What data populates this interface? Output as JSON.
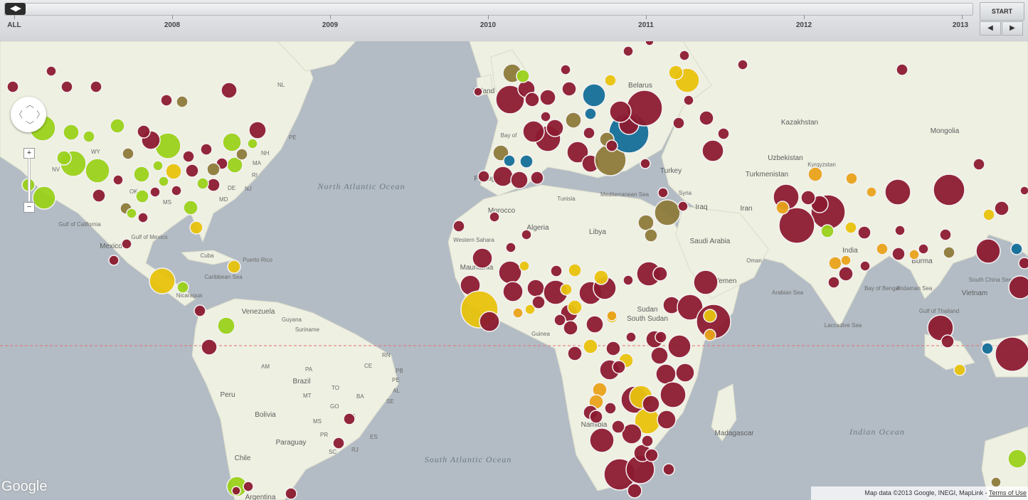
{
  "timeline": {
    "handle_label": "◀▶",
    "all_label": "ALL",
    "years": [
      "2008",
      "2009",
      "2010",
      "2011",
      "2012",
      "2013"
    ],
    "start_label": "START",
    "prev_icon": "◀",
    "next_icon": "▶"
  },
  "map": {
    "zoom_in": "+",
    "zoom_out": "−",
    "google_label": "Google",
    "attribution": "Map data ©2013 Google, INEGI, MapLink",
    "terms_label": "Terms of Use",
    "country_labels": [
      "Venezuela",
      "Guyana",
      "Suriname",
      "Brazil",
      "Peru",
      "Bolivia",
      "Paraguay",
      "Chile",
      "Argentina",
      "Mexico",
      "Cuba",
      "Puerto Rico",
      "Nicaragua",
      "Algeria",
      "Libya",
      "Morocco",
      "Western Sahara",
      "Mauritania",
      "Sudan",
      "South Sudan",
      "Namibia",
      "Madagascar",
      "Turkey",
      "Syria",
      "Iraq",
      "Iran",
      "Saudi Arabia",
      "Oman",
      "Kazakhstan",
      "Uzbekistan",
      "Kyrgyzstan",
      "Turkmenistan",
      "Mongolia",
      "Belarus",
      "Vietnam",
      "Tunisia",
      "Portugal",
      "Ireland",
      "Yemen",
      "India",
      "Burma"
    ],
    "ocean_labels": [
      "North Atlantic Ocean",
      "South Atlantic Ocean",
      "Indian Ocean",
      "Arabian Sea",
      "Bay of Bengal",
      "Andaman Sea",
      "South China Sea",
      "Caribbean Sea",
      "Gulf of Mexico",
      "Gulf of California",
      "Mediterranean Sea",
      "Laccadive Sea",
      "Guinea",
      "Gulf of Thailand",
      "Bay of"
    ],
    "state_labels": [
      "WY",
      "NV",
      "OK",
      "MS",
      "PE",
      "NH",
      "MA",
      "RI",
      "NJ",
      "MD",
      "DE",
      "NL",
      "RN",
      "CE",
      "PB",
      "PE",
      "AL",
      "SE",
      "BA",
      "ES",
      "RJ",
      "AM",
      "PA",
      "TO",
      "MT",
      "GO",
      "MG",
      "MS",
      "PR",
      "SC"
    ],
    "legend_colors": {
      "maroon": "#8c1a30",
      "lime": "#9ad11a",
      "yellow": "#e8c20d",
      "olive": "#8d7a3a",
      "blue": "#136e98",
      "orange": "#e8a21a"
    }
  }
}
